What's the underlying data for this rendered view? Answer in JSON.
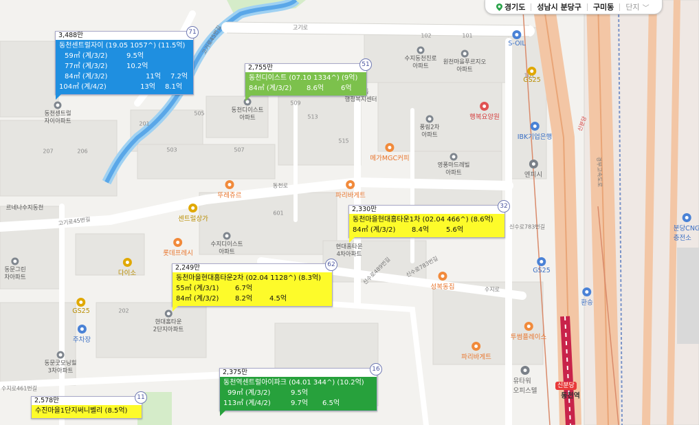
{
  "breadcrumb": {
    "region": "경기도",
    "city": "성남시 분당구",
    "dong": "구미동",
    "filter": "단지"
  },
  "listings": [
    {
      "count": "3,488만",
      "badge": "71",
      "title": "동천센트럴자이 (19.05 1057^) (11.5억)",
      "rows": [
        [
          "59㎡ (계/3/2)",
          "9.5억",
          ""
        ],
        [
          "77㎡ (계/3/2)",
          "10.2억",
          ""
        ],
        [
          "84㎡ (계/3/2)",
          "11억",
          "7.2억"
        ],
        [
          "104㎡ (계/4/2)",
          "13억",
          "8.1억"
        ]
      ]
    },
    {
      "count": "2,755만",
      "badge": "51",
      "title": "동천디이스트 (07.10 1334^) (9억)",
      "rows": [
        [
          "84㎡ (계/3/2)",
          "8.6억",
          "6억"
        ]
      ]
    },
    {
      "count": "2,330만",
      "badge": "32",
      "title": "동천마을현대홈타운1차 (02.04 466^) (8.6억)",
      "rows": [
        [
          "84㎡ (계/3/2)",
          "8.4억",
          "5.6억"
        ]
      ]
    },
    {
      "count": "2,249만",
      "badge": "62",
      "title": "동천마을현대홈타운2차 (02.04 1128^) (8.3억)",
      "rows": [
        [
          "55㎡ (계/3/1)",
          "6.7억",
          ""
        ],
        [
          "84㎡ (계/3/2)",
          "8.2억",
          "4.5억"
        ]
      ]
    },
    {
      "count": "2,375만",
      "badge": "16",
      "title": "동천역센트럴아이파크 (04.01 344^) (10.2억)",
      "rows": [
        [
          "99㎡ (계/3/2)",
          "9.5억",
          ""
        ],
        [
          "113㎡ (계/4/2)",
          "9.7억",
          "6.5억"
        ]
      ]
    },
    {
      "count": "2,578만",
      "badge": "11",
      "title": "수진마을1단지써니벨리 (8.5억)",
      "rows": []
    }
  ],
  "pois": {
    "soil": "S-OIL",
    "gs25_a": "GS25",
    "gs25_b": "GS25",
    "gs25_c": "GS25",
    "happy": "행복요양원",
    "ibk": "IBK기업은행",
    "mega": "메가MGC커피",
    "paris_a": "파리바게트",
    "paris_b": "파리바게트",
    "tous": "뚜레쥬르",
    "center": "센트럴상가",
    "lotte": "롯데프레시",
    "daiso": "다이소",
    "sungbo": "성복동집",
    "hansum": "환승",
    "tuup": "투썸플레이스",
    "bundang_cng": "분당CNG\n충전소",
    "parking": "주차장",
    "yutower": "유타워\n오피스텔",
    "ennpc": "엔피시"
  },
  "places": {
    "apt_suji_jinro": "수지동천진로\n아파트",
    "apt_wonchon": "원천마을푸르지오\n아파트",
    "apt_dongcheon_hall": "동천동\n행정복지센터",
    "apt_pungrim": "풍림2차\n아파트",
    "apt_yeongpung": "영풍마드레빌\n아파트",
    "apt_suji_east": "수지디이스트\n아파트",
    "apt_hyundai_town": "현대홈타운\n4차아파트",
    "apt_hyundai2": "현대홈타운\n2단지아파트",
    "apt_dongmun_green": "동문그린\n차아파트",
    "apt_dongmun_good": "동문굿모닝힐\n3차아파트",
    "apt_central": "동천센트럴\n자이아파트",
    "apt_dongcheon_east": "동천디이스트\n아파트",
    "apt_renai": "르네나수지동천"
  },
  "roads": {
    "gogi": "고기로",
    "gogi45": "고기로45번길",
    "gogi45b": "고기로45번길",
    "dongcheon": "동천로",
    "sinsu783": "신수로783번길",
    "sinsu783b": "신수로783번길",
    "sinsu489": "신수로489번길",
    "suji461": "수지로461번길",
    "suji": "수지로",
    "gyungbu": "경부고속도로",
    "dongcheon_station": "동천역",
    "sinbundang": "신분당"
  },
  "colors": {
    "blue_card": "#1f8fe0",
    "lime_card": "#7cc14c",
    "yellow_card": "#fdfb2a",
    "green_card": "#27a13c",
    "stream": "#5aa7e8",
    "park": "#d5ecc9",
    "subway": "#c8234a"
  },
  "station_tag": "신분당"
}
